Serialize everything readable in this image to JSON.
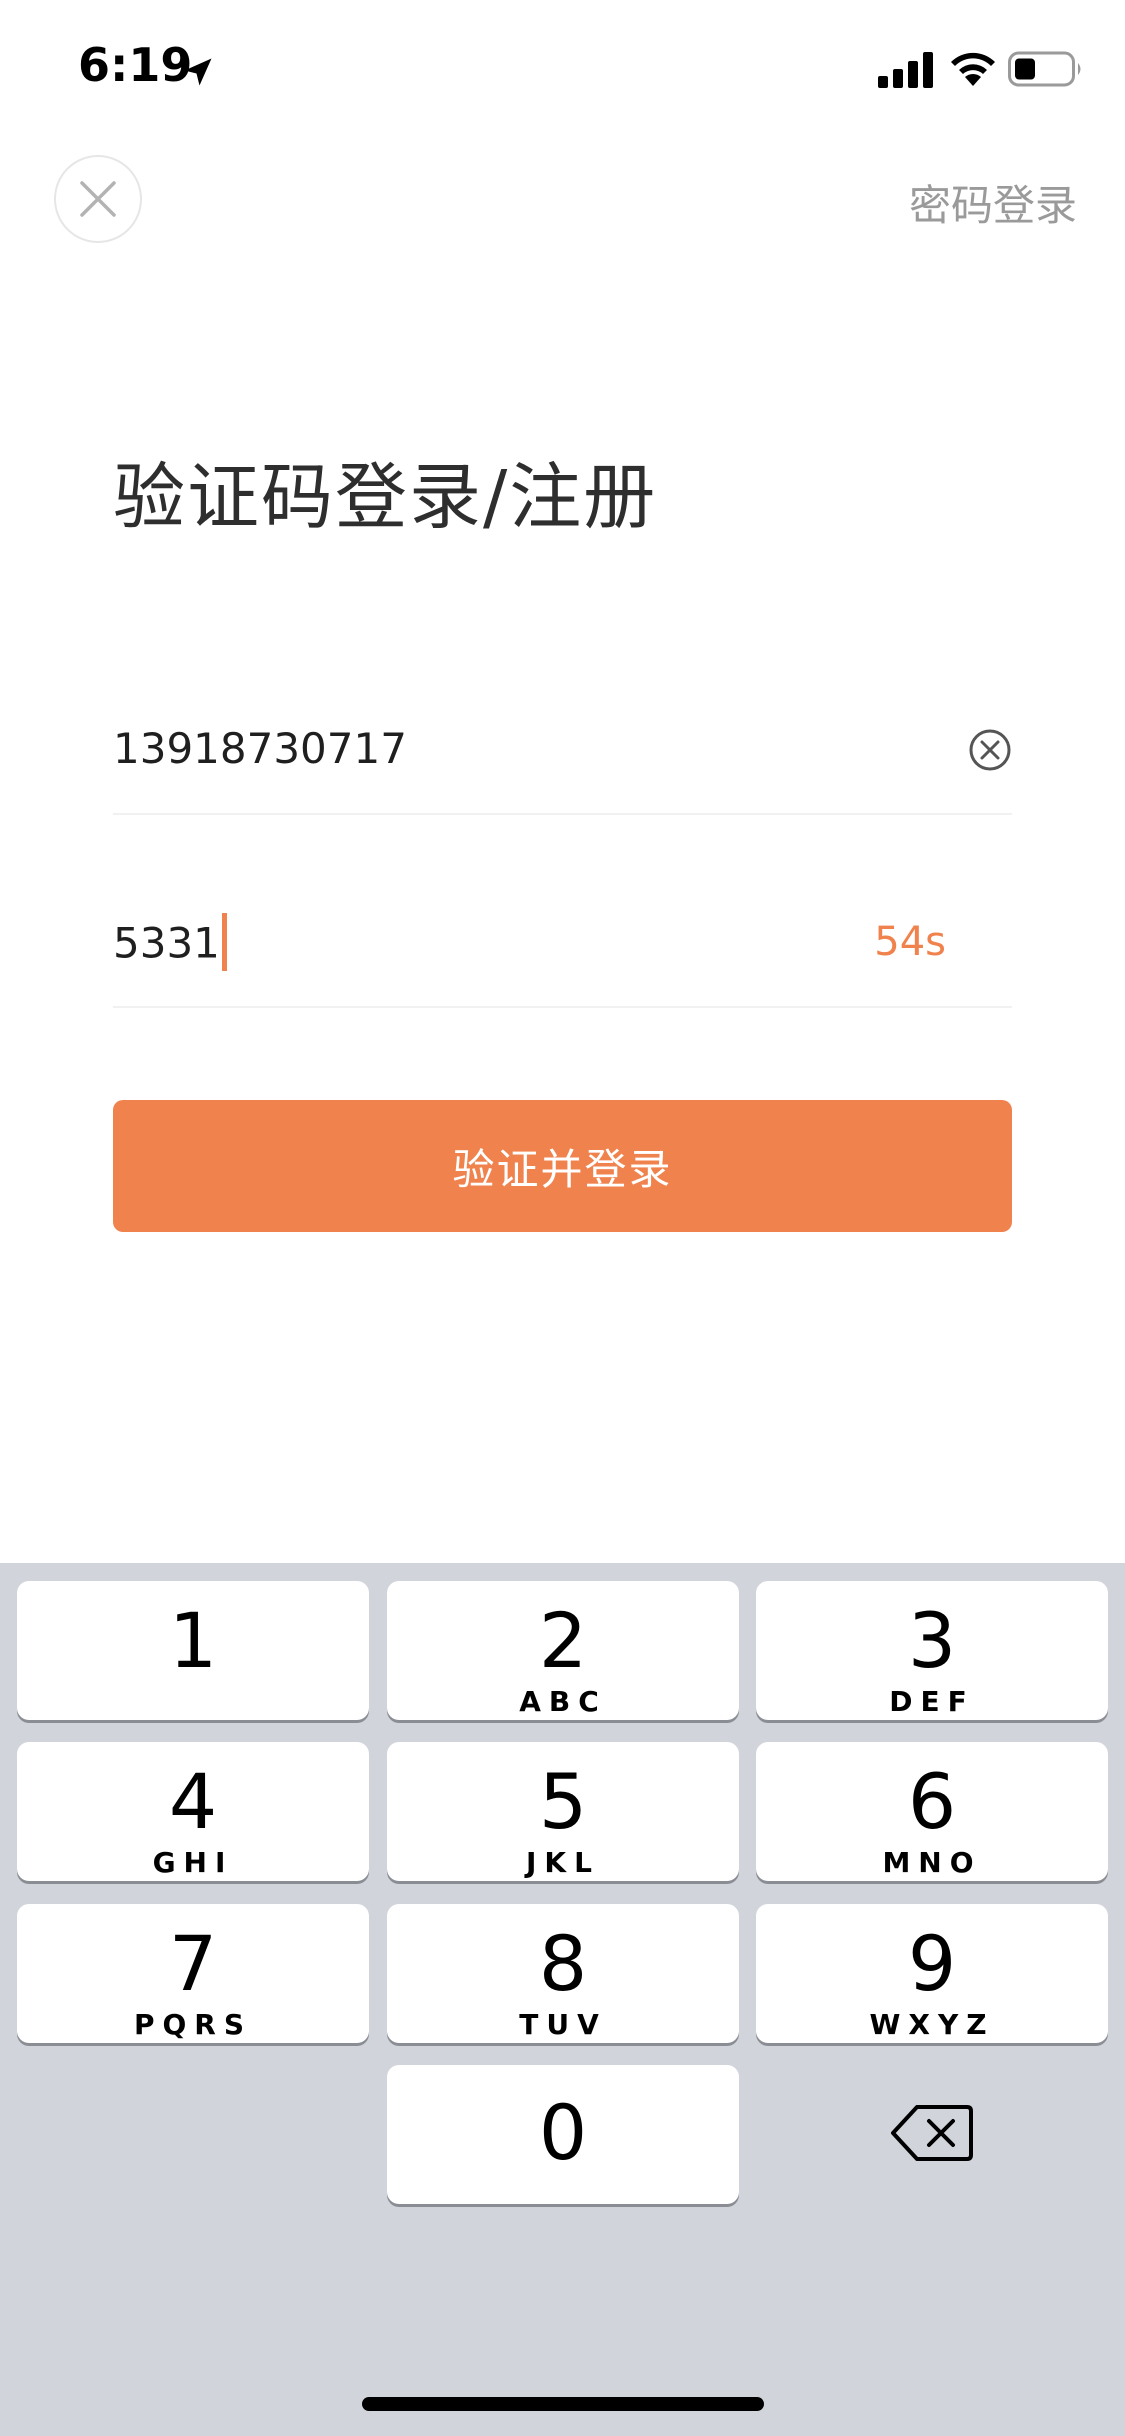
{
  "status_bar": {
    "time": "6:19"
  },
  "nav": {
    "password_login": "密码登录"
  },
  "title": "验证码登录/注册",
  "phone_field": {
    "value": "13918730717"
  },
  "code_field": {
    "value": "5331",
    "countdown": "54s"
  },
  "submit_label": "验证并登录",
  "keyboard": {
    "keys": [
      {
        "digit": "1",
        "letters": ""
      },
      {
        "digit": "2",
        "letters": "ABC"
      },
      {
        "digit": "3",
        "letters": "DEF"
      },
      {
        "digit": "4",
        "letters": "GHI"
      },
      {
        "digit": "5",
        "letters": "JKL"
      },
      {
        "digit": "6",
        "letters": "MNO"
      },
      {
        "digit": "7",
        "letters": "PQRS"
      },
      {
        "digit": "8",
        "letters": "TUV"
      },
      {
        "digit": "9",
        "letters": "WXYZ"
      },
      {
        "digit": "0",
        "letters": ""
      }
    ]
  },
  "colors": {
    "accent": "#f0834d",
    "keyboard_bg": "#d1d5db",
    "secondary_text": "#9a9a9a"
  },
  "icons": [
    "location-arrow-icon",
    "signal-icon",
    "wifi-icon",
    "battery-icon",
    "close-icon",
    "clear-icon",
    "delete-icon"
  ]
}
